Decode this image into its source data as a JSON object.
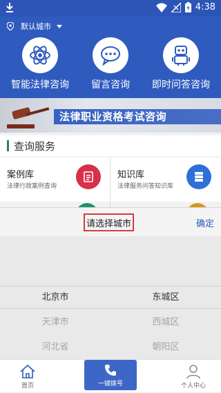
{
  "status_bar": {
    "time": "4:38"
  },
  "header": {
    "city_label": "默认城市"
  },
  "features": [
    {
      "label": "智能法律咨询",
      "icon": "atom-icon"
    },
    {
      "label": "留言咨询",
      "icon": "chat-bubble-icon"
    },
    {
      "label": "即时问答咨询",
      "icon": "robot-icon"
    }
  ],
  "banner": {
    "text": "法律职业资格考试咨询"
  },
  "section": {
    "title": "查询服务"
  },
  "services": [
    {
      "title": "案例库",
      "subtitle": "法律行政案例查询",
      "icon": "document-icon",
      "color": "#d8304a"
    },
    {
      "title": "知识库",
      "subtitle": "法律服务问答知识库",
      "icon": "database-icon",
      "color": "#2f6fd8"
    }
  ],
  "picker": {
    "title": "请选择城市",
    "confirm_label": "确定",
    "provinces": [
      "北京市",
      "天津市",
      "河北省"
    ],
    "districts": [
      "东城区",
      "西城区",
      "朝阳区"
    ]
  },
  "tabbar": {
    "home": "首页",
    "call": "一键拨号",
    "profile": "个人中心"
  },
  "colors": {
    "primary": "#2f5bbf",
    "accent_red": "#d83a3a"
  }
}
